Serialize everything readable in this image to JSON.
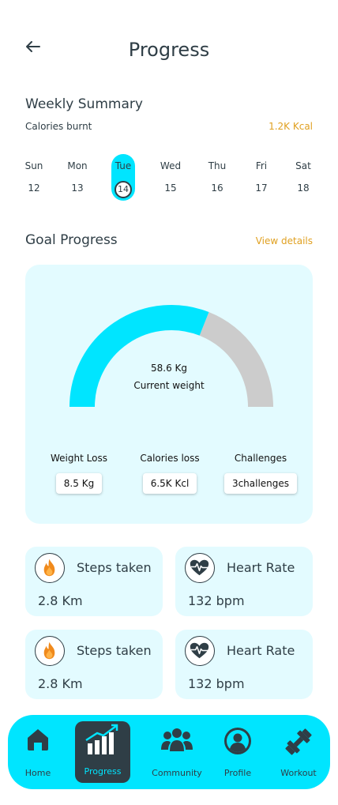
{
  "header": {
    "title": "Progress"
  },
  "weekly": {
    "title": "Weekly Summary",
    "calories_label": "Calories burnt",
    "calories_value": "1.2K Kcal",
    "days": [
      {
        "name": "Sun",
        "date": "12"
      },
      {
        "name": "Mon",
        "date": "13"
      },
      {
        "name": "Tue",
        "date": "14",
        "active": true
      },
      {
        "name": "Wed",
        "date": "15"
      },
      {
        "name": "Thu",
        "date": "16"
      },
      {
        "name": "Fri",
        "date": "17"
      },
      {
        "name": "Sat",
        "date": "18"
      }
    ]
  },
  "goal": {
    "title": "Goal Progress",
    "view_details": "View details",
    "weight_value": "58.6 Kg",
    "weight_label": "Current weight",
    "progress_fraction": 0.62,
    "stats": [
      {
        "label": "Weight Loss",
        "value": "8.5 Kg"
      },
      {
        "label": "Calories loss",
        "value": "6.5K Kcl"
      },
      {
        "label": "Challenges",
        "value": "3challenges"
      }
    ]
  },
  "metrics": [
    {
      "label": "Steps taken",
      "value": "2.8 Km",
      "icon": "fire-icon"
    },
    {
      "label": "Heart Rate",
      "value": "132 bpm",
      "icon": "heart-rate-icon"
    },
    {
      "label": "Steps taken",
      "value": "2.8 Km",
      "icon": "fire-icon"
    },
    {
      "label": "Heart Rate",
      "value": "132 bpm",
      "icon": "heart-rate-icon"
    }
  ],
  "nav": {
    "items": [
      {
        "label": "Home",
        "icon": "home-icon"
      },
      {
        "label": "Progress",
        "icon": "chart-icon",
        "active": true
      },
      {
        "label": "Community",
        "icon": "community-icon"
      },
      {
        "label": "Profile",
        "icon": "profile-icon"
      },
      {
        "label": "Workout",
        "icon": "dumbbell-icon"
      }
    ]
  },
  "colors": {
    "accent": "#00e5ff",
    "dark": "#2f3e46",
    "highlight": "#e0a020",
    "card": "#e3fbff",
    "gauge_rest": "#cccccc"
  }
}
